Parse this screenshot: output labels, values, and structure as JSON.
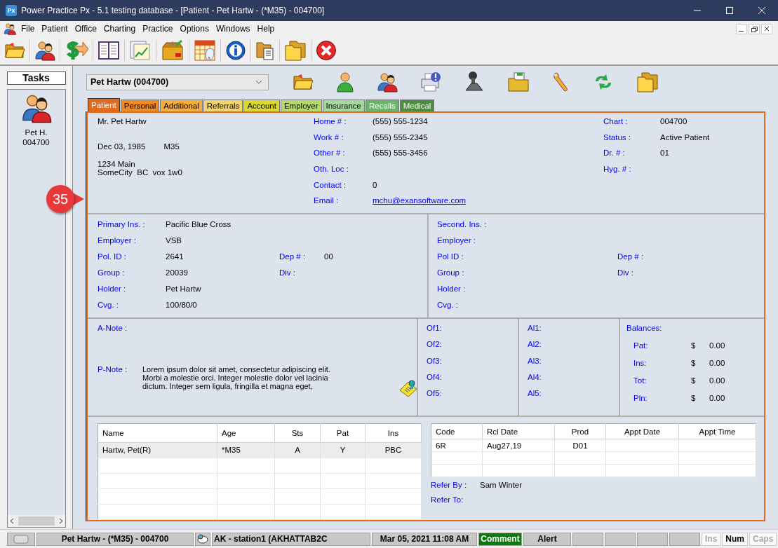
{
  "window": {
    "title": "Power Practice Px - 5.1 testing database - [Patient - Pet Hartw - (*M35) - 004700]",
    "app_logo": "Px"
  },
  "menu": [
    "File",
    "Patient",
    "Office",
    "Charting",
    "Practice",
    "Options",
    "Windows",
    "Help"
  ],
  "tasks": {
    "title": "Tasks",
    "items": [
      {
        "name": "Pet H.",
        "number": "004700"
      }
    ]
  },
  "patient_selector": {
    "value": "Pet Hartw (004700)"
  },
  "tabs": [
    {
      "label": "Patient",
      "selected": true,
      "color": "#e2691e"
    },
    {
      "label": "Personal",
      "selected": false,
      "color": "#ef8a26"
    },
    {
      "label": "Additional",
      "selected": false,
      "color": "#f6ad3c"
    },
    {
      "label": "Referrals",
      "selected": false,
      "color": "#f3d46e"
    },
    {
      "label": "Account",
      "selected": false,
      "color": "#dcd832"
    },
    {
      "label": "Employer",
      "selected": false,
      "color": "#b7d96c"
    },
    {
      "label": "Insurance",
      "selected": false,
      "color": "#a4d89c"
    },
    {
      "label": "Recalls",
      "selected": false,
      "color": "#6bb36b"
    },
    {
      "label": "Medical",
      "selected": false,
      "color": "#4c8d3f"
    }
  ],
  "patient": {
    "name": "Mr. Pet Hartw",
    "birth_date": "Dec 03, 1985",
    "age_sex": "M35",
    "address": [
      "1234 Main",
      "SomeCity  BC  vox 1w0"
    ],
    "contacts": [
      {
        "label": "Home # :",
        "value": "(555) 555-1234"
      },
      {
        "label": "Work # :",
        "value": "(555) 555-2345"
      },
      {
        "label": "Other # :",
        "value": "(555) 555-3456"
      },
      {
        "label": "Oth. Loc :"
      },
      {
        "label": "Contact :",
        "value": "0"
      },
      {
        "label": "Email :",
        "value": "mchu@exansoftware.com",
        "kind": "link"
      }
    ],
    "chart": [
      {
        "label": "Chart :",
        "value": "004700"
      },
      {
        "label": "Status :",
        "value": "Active Patient"
      },
      {
        "label": "Dr. # :",
        "value": "01"
      },
      {
        "label": "Hyg. # :"
      }
    ]
  },
  "insurance": {
    "primary": [
      [
        {
          "label": "Primary Ins. :",
          "value": "Pacific Blue Cross"
        }
      ],
      [
        {
          "label": "Employer :",
          "value": "VSB"
        }
      ],
      [
        {
          "label": "Pol. ID :",
          "value": "2641"
        },
        {
          "label": "Dep # :",
          "value": "00"
        }
      ],
      [
        {
          "label": "Group :",
          "value": "20039"
        },
        {
          "label": "Div :"
        }
      ],
      [
        {
          "label": "Holder :",
          "value": "Pet Hartw"
        }
      ],
      [
        {
          "label": "Cvg. :",
          "value": "100/80/0"
        }
      ]
    ],
    "secondary": [
      [
        {
          "label": "Second. Ins. :"
        }
      ],
      [
        {
          "label": "Employer :"
        }
      ],
      [
        {
          "label": "Pol ID :"
        },
        {
          "label": "Dep # :"
        }
      ],
      [
        {
          "label": "Group :"
        },
        {
          "label": "Div :"
        }
      ],
      [
        {
          "label": "Holder :"
        }
      ],
      [
        {
          "label": "Cvg. :"
        }
      ]
    ]
  },
  "notes": {
    "a_note_label": "A-Note :",
    "p_note_label": "P-Note :",
    "p_note": "Lorem ipsum dolor sit amet, consectetur adipiscing elit. Morbi a molestie orci. Integer molestie dolor vel lacinia dictum. Integer sem ligula, fringilla et magna eget,"
  },
  "office_fields": [
    "Of1:",
    "Of2:",
    "Of3:",
    "Of4:",
    "Of5:"
  ],
  "alert_fields": [
    "Al1:",
    "Al2:",
    "Al3:",
    "Al4:",
    "Al5:"
  ],
  "balances": {
    "title": "Balances:",
    "rows": [
      {
        "label": "Pat:",
        "currency": "$",
        "amount": "0.00"
      },
      {
        "label": "Ins:",
        "currency": "$",
        "amount": "0.00"
      },
      {
        "label": "Tot:",
        "currency": "$",
        "amount": "0.00"
      },
      {
        "label": "Pln:",
        "currency": "$",
        "amount": "0.00"
      }
    ]
  },
  "family_table": {
    "columns": [
      "Name",
      "Age",
      "Sts",
      "Pat",
      "Ins"
    ],
    "rows": [
      {
        "cells": [
          "Hartw, Pet(R)",
          "*M35",
          "A",
          "Y",
          "PBC"
        ],
        "selected": true
      }
    ]
  },
  "recall_table": {
    "columns": [
      "Code",
      "Rcl Date",
      "Prod",
      "Appt Date",
      "Appt Time"
    ],
    "rows": [
      {
        "cells": [
          "6R",
          "Aug27,19",
          "D01",
          "",
          ""
        ],
        "selected": false
      }
    ]
  },
  "referrals": [
    {
      "label": "Refer By :",
      "value": "Sam Winter"
    },
    {
      "label": "Refer To:"
    }
  ],
  "badge": "35",
  "status_bar": {
    "patient": "Pet Hartw - (*M35) - 004700",
    "station": "AK - station1 (AKHATTAB2C",
    "datetime": "Mar 05, 2021 11:08 AM",
    "comment": "Comment",
    "alert": "Alert",
    "keys": [
      {
        "label": "Ins",
        "on": false
      },
      {
        "label": "Num",
        "on": true
      },
      {
        "label": "Caps",
        "on": false
      }
    ]
  }
}
